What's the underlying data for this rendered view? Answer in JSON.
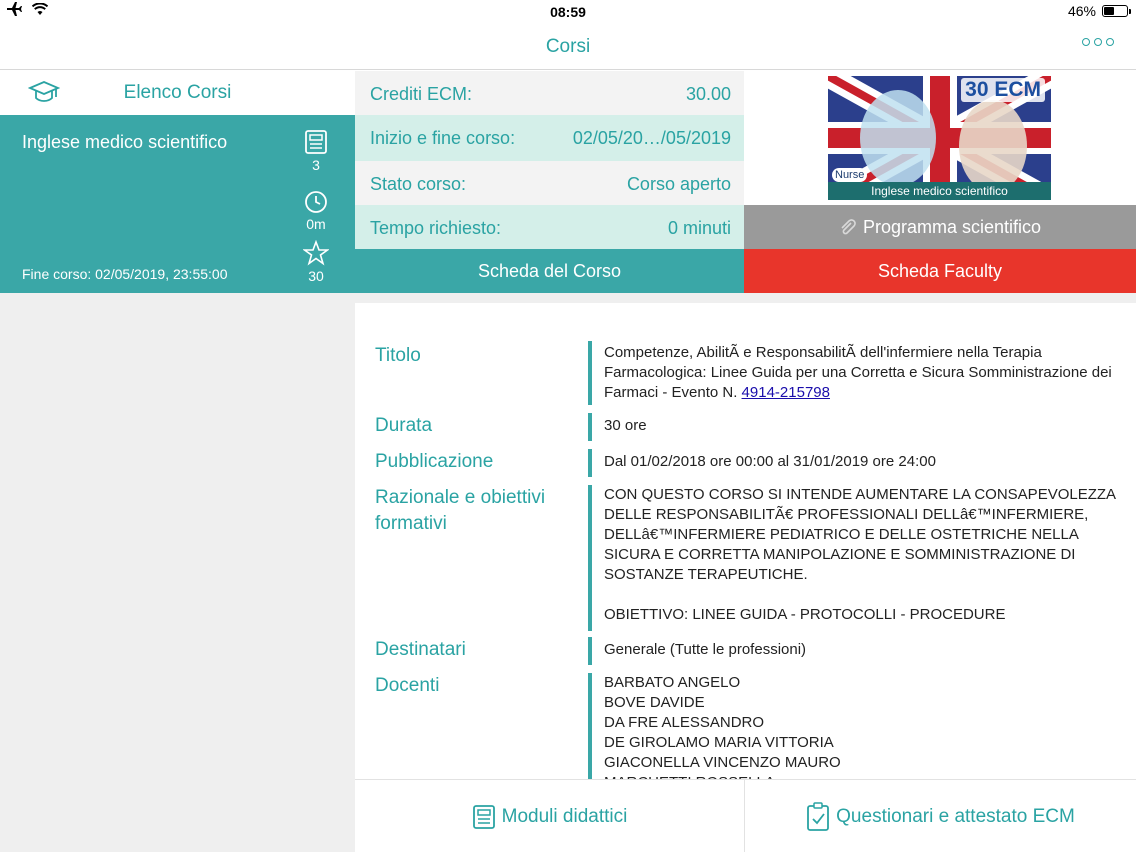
{
  "status_bar": {
    "time": "08:59",
    "battery": "46%",
    "battery_level": 0.46
  },
  "nav": {
    "title": "Corsi"
  },
  "left": {
    "header_label": "Elenco Corsi",
    "course": {
      "name": "Inglese medico scientifico",
      "end": "Fine corso: 02/05/2019, 23:55:00",
      "modules_count": "3",
      "time": "0m",
      "credits": "30"
    }
  },
  "info": {
    "rows": [
      {
        "key": "Crediti ECM:",
        "value": "30.00"
      },
      {
        "key": "Inizio e fine corso:",
        "value": "02/05/20…/05/2019"
      },
      {
        "key": "Stato corso:",
        "value": "Corso aperto"
      },
      {
        "key": "Tempo richiesto:",
        "value": "0 minuti"
      }
    ],
    "thumb_ecm": "30 ECM",
    "thumb_caption": "Inglese medico scientifico",
    "thumb_logo": "Nurse"
  },
  "buttons": {
    "programma": "Programma scientifico",
    "scheda_corso": "Scheda del Corso",
    "scheda_faculty": "Scheda Faculty"
  },
  "details": {
    "titolo_label": "Titolo",
    "titolo_value": "Competenze, AbilitÃ  e ResponsabilitÃ  dell'infermiere nella Terapia Farmacologica: Linee Guida per una Corretta e Sicura Somministrazione dei Farmaci - Evento N. ",
    "titolo_link": "4914-215798",
    "durata_label": "Durata",
    "durata_value": "30 ore",
    "pubblicazione_label": "Pubblicazione",
    "pubblicazione_value": "Dal 01/02/2018 ore 00:00 al 31/01/2019 ore 24:00",
    "razionale_label": "Razionale e obiettivi formativi",
    "razionale_value": "CON QUESTO CORSO SI INTENDE AUMENTARE LA CONSAPEVOLEZZA DELLE RESPONSABILITÃ€ PROFESSIONALI DELLâ€™INFERMIERE, DELLâ€™INFERMIERE PEDIATRICO E DELLE OSTETRICHE NELLA SICURA E CORRETTA MANIPOLAZIONE E SOMMINISTRAZIONE DI SOSTANZE TERAPEUTICHE.\n\nOBIETTIVO: LINEE GUIDA - PROTOCOLLI - PROCEDURE",
    "destinatari_label": "Destinatari",
    "destinatari_value": "Generale (Tutte le professioni)",
    "docenti_label": "Docenti",
    "docenti_value": "BARBATO ANGELO\nBOVE DAVIDE\nDA FRE ALESSANDRO\nDE GIROLAMO MARIA VITTORIA\nGIACONELLA VINCENZO MAURO\nMARCHETTI ROSSELLA"
  },
  "tabs": {
    "moduli": "Moduli didattici",
    "questionari": "Questionari e attestato ECM"
  }
}
